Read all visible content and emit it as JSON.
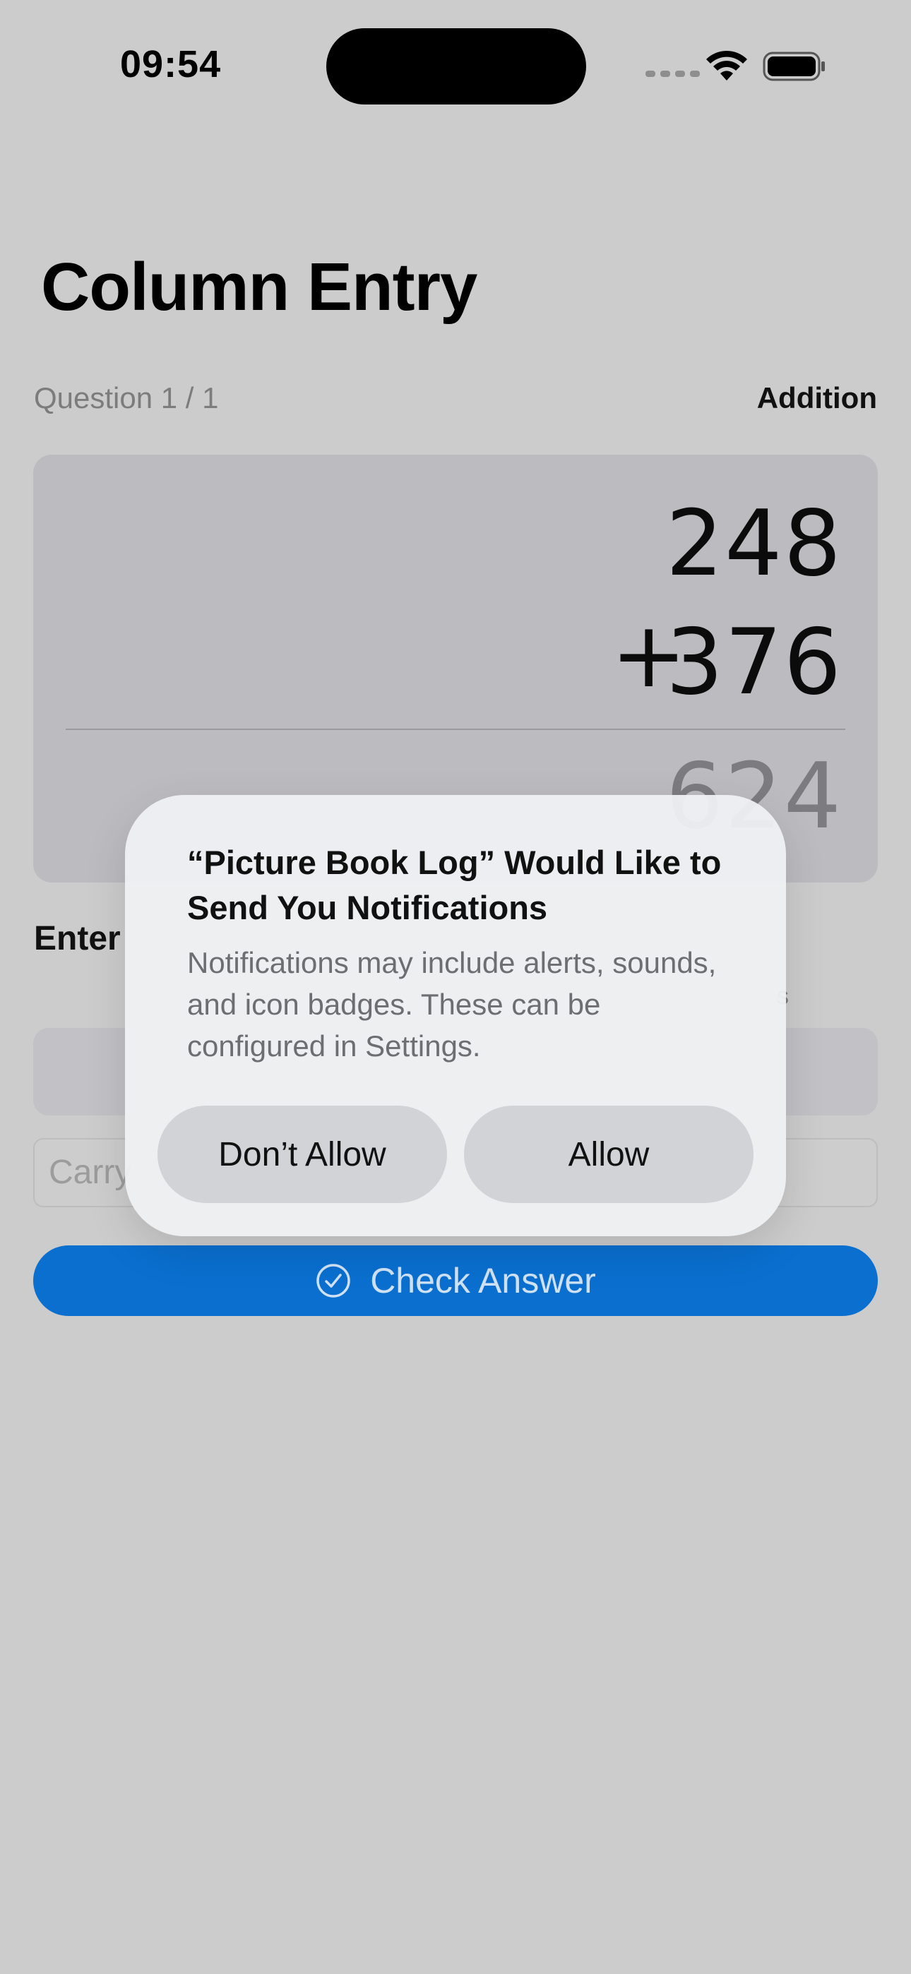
{
  "status_bar": {
    "time": "09:54"
  },
  "screen": {
    "title": "Column Entry",
    "question_counter": "Question 1 / 1",
    "operation": "Addition",
    "problem": {
      "top_number": "248",
      "operator": "+",
      "bottom_number": "376",
      "answer": "624"
    },
    "enter_label": "Enter",
    "hint_fragment": "s",
    "carry_placeholder": "Carry",
    "check_button_label": "Check Answer"
  },
  "alert": {
    "title": "“Picture Book Log” Would Like to Send You Notifications",
    "message": "Notifications may include alerts, sounds, and icon badges. These can be configured in Settings.",
    "deny_label": "Don’t Allow",
    "allow_label": "Allow"
  },
  "icons": {
    "status": [
      "cellular-signal-icon",
      "wifi-icon",
      "battery-icon"
    ],
    "check_button": "checkmark-circle-icon"
  },
  "colors": {
    "accent": "#0a6fcf",
    "background": "#cccccc"
  }
}
